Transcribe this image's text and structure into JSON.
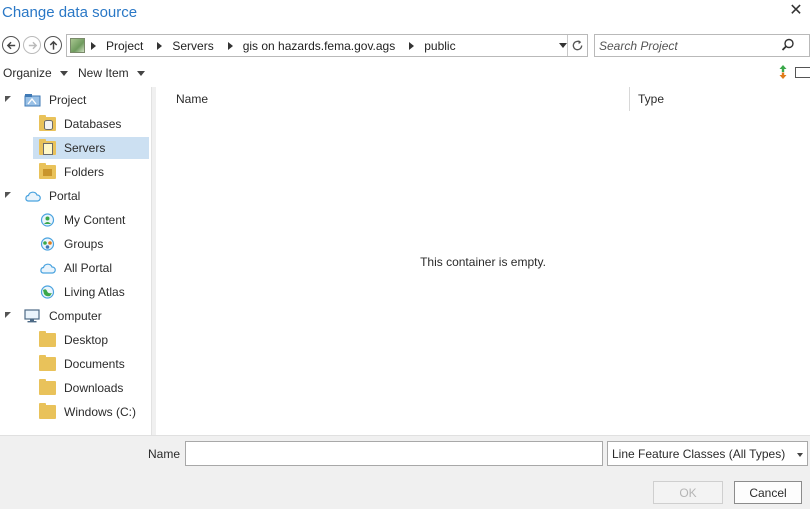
{
  "window": {
    "title": "Change data source",
    "close_glyph": "✕"
  },
  "nav": {
    "back_icon": "back-arrow-icon",
    "forward_icon": "forward-arrow-icon",
    "up_icon": "up-arrow-icon"
  },
  "address": {
    "icon": "project-thumbnail-icon",
    "crumbs": [
      "Project",
      "Servers",
      "gis on hazards.fema.gov.ags",
      "public"
    ]
  },
  "search": {
    "placeholder": "Search Project",
    "value": ""
  },
  "toolbar": {
    "organize_label": "Organize",
    "new_item_label": "New Item",
    "sort_icon": "sort-order-icon",
    "view_icon": "view-toggle-icon"
  },
  "tree": {
    "items": [
      {
        "label": "Project",
        "icon": "project-icon",
        "level": 0,
        "expanded": true
      },
      {
        "label": "Databases",
        "icon": "databases-folder-icon",
        "level": 1
      },
      {
        "label": "Servers",
        "icon": "servers-folder-icon",
        "level": 1,
        "selected": true
      },
      {
        "label": "Folders",
        "icon": "folders-folder-icon",
        "level": 1
      },
      {
        "label": "Portal",
        "icon": "portal-cloud-icon",
        "level": 0,
        "expanded": true
      },
      {
        "label": "My Content",
        "icon": "my-content-icon",
        "level": 1
      },
      {
        "label": "Groups",
        "icon": "groups-icon",
        "level": 1
      },
      {
        "label": "All Portal",
        "icon": "all-portal-cloud-icon",
        "level": 1
      },
      {
        "label": "Living Atlas",
        "icon": "living-atlas-icon",
        "level": 1
      },
      {
        "label": "Computer",
        "icon": "computer-icon",
        "level": 0,
        "expanded": true
      },
      {
        "label": "Desktop",
        "icon": "desktop-folder-icon",
        "level": 1
      },
      {
        "label": "Documents",
        "icon": "documents-folder-icon",
        "level": 1
      },
      {
        "label": "Downloads",
        "icon": "downloads-folder-icon",
        "level": 1
      },
      {
        "label": "Windows (C:)",
        "icon": "drive-folder-icon",
        "level": 1
      }
    ]
  },
  "content": {
    "columns": [
      "Name",
      "Type"
    ],
    "empty_message": "This container is empty."
  },
  "footer": {
    "name_label": "Name",
    "name_value": "",
    "filter_selected": "Line Feature Classes (All Types)",
    "ok_label": "OK",
    "cancel_label": "Cancel"
  },
  "colors": {
    "title": "#2a78c6",
    "selection": "#cce0f2",
    "folder": "#e9c25a",
    "cloud": "#4aa3df"
  }
}
